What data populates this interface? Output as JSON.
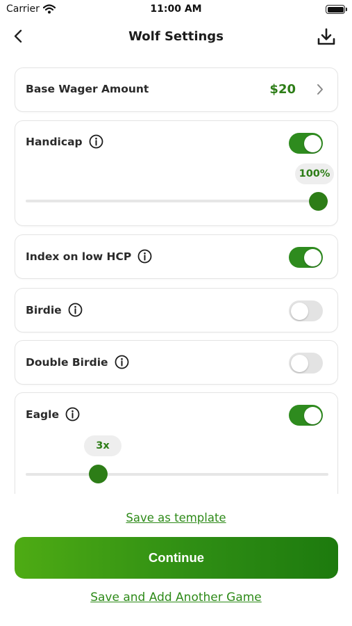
{
  "status_bar": {
    "carrier": "Carrier",
    "time": "11:00 AM"
  },
  "nav": {
    "title": "Wolf Settings",
    "back_icon": "chevron-left-icon",
    "download_icon": "download-icon"
  },
  "settings": {
    "base_wager": {
      "label": "Base Wager Amount",
      "value": "$20"
    },
    "handicap": {
      "label": "Handicap",
      "enabled": true,
      "slider_label": "100%",
      "slider_fraction": 1.0
    },
    "index_low_hcp": {
      "label": "Index on low HCP",
      "enabled": true
    },
    "birdie": {
      "label": "Birdie",
      "enabled": false
    },
    "double_birdie": {
      "label": "Double Birdie",
      "enabled": false
    },
    "eagle": {
      "label": "Eagle",
      "enabled": true,
      "slider_label": "3x",
      "slider_fraction": 0.24
    }
  },
  "actions": {
    "save_template": "Save as template",
    "continue": "Continue",
    "save_add_game": "Save and Add Another Game"
  },
  "colors": {
    "accent": "#2d7d17",
    "toggle_on": "#2e8b1e",
    "toggle_off": "#e3e3e3"
  }
}
